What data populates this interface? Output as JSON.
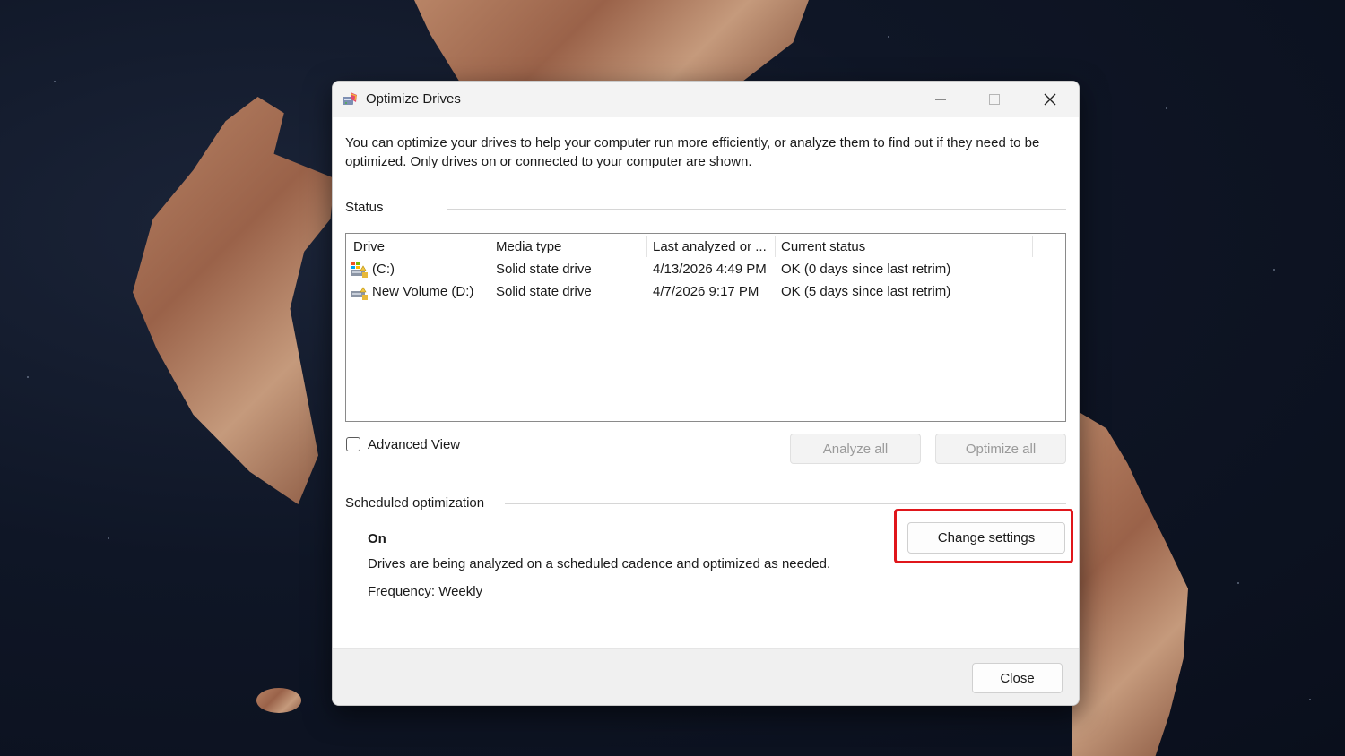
{
  "window": {
    "title": "Optimize Drives",
    "icon": "optimize-drives-app-icon",
    "controls": {
      "minimize": "minimize-icon",
      "maximize": "maximize-icon",
      "close": "close-icon"
    }
  },
  "description": "You can optimize your drives to help your computer run more efficiently, or analyze them to find out if they need to be optimized. Only drives on or connected to your computer are shown.",
  "status": {
    "label": "Status",
    "columns": [
      "Drive",
      "Media type",
      "Last analyzed or ...",
      "Current status"
    ],
    "rows": [
      {
        "drive": "(C:)",
        "icon": "system-drive-icon",
        "media_type": "Solid state drive",
        "last_analyzed": "4/13/2026 4:49 PM",
        "current_status": "OK (0 days since last retrim)"
      },
      {
        "drive": "New Volume (D:)",
        "icon": "drive-icon",
        "media_type": "Solid state drive",
        "last_analyzed": "4/7/2026 9:17 PM",
        "current_status": "OK (5 days since last retrim)"
      }
    ]
  },
  "advanced_view": {
    "label": "Advanced View",
    "checked": false
  },
  "buttons": {
    "analyze_all": "Analyze all",
    "optimize_all": "Optimize all",
    "change_settings": "Change settings",
    "close": "Close"
  },
  "scheduled": {
    "label": "Scheduled optimization",
    "state": "On",
    "description": "Drives are being analyzed on a scheduled cadence and optimized as needed.",
    "frequency": "Frequency: Weekly"
  },
  "colors": {
    "highlight": "#e0161b",
    "title_bar": "#f3f3f3",
    "footer": "#f0f0f0"
  }
}
